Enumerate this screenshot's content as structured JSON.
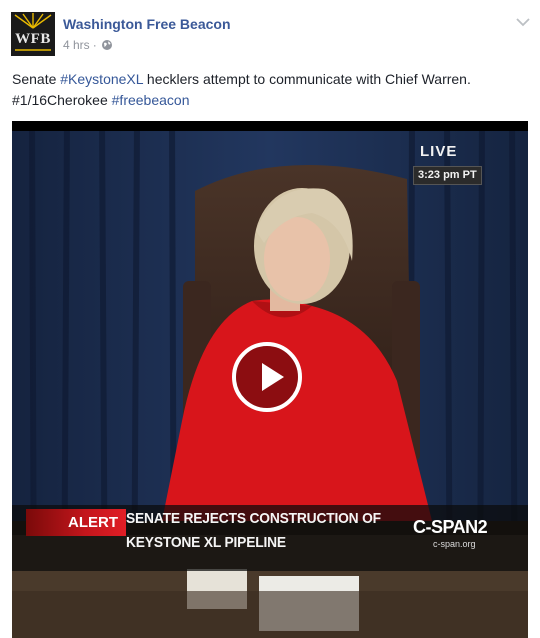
{
  "post": {
    "page_name": "Washington Free Beacon",
    "avatar_text": "WFB",
    "timestamp": "4 hrs",
    "separator": "·",
    "audience_icon": "globe-icon",
    "menu_icon": "chevron-down-icon",
    "text": {
      "part1": "Senate ",
      "hashtag1": "#KeystoneXL",
      "part2": " hecklers attempt to communicate with Chief Warren.",
      "part3": "#1/16Cherokee ",
      "hashtag2": "#freebeacon"
    },
    "colors": {
      "link": "#365899",
      "name": "#3b5998",
      "meta": "#90949c"
    }
  },
  "video": {
    "live": "LIVE",
    "time": "3:23 pm PT",
    "alert": "ALERT",
    "headline_line1": "SENATE REJECTS CONSTRUCTION OF",
    "headline_line2": "KEYSTONE XL PIPELINE",
    "network": "C-SPAN2",
    "network_url": "c-span.org",
    "play_icon": "play-icon",
    "colors": {
      "alert_red": "#c4161c",
      "jacket_red": "#d8151b",
      "curtain": "#1b2c4e"
    }
  }
}
